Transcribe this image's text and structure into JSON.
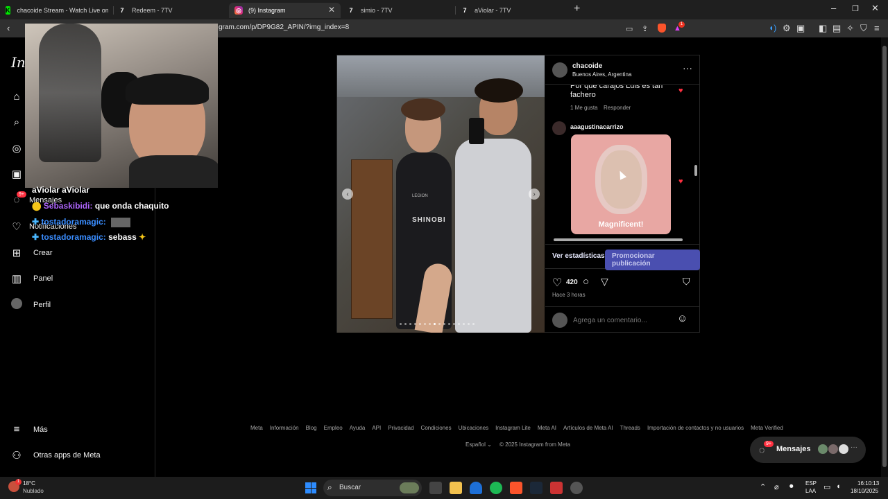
{
  "tabs": [
    {
      "title": "chacoide Stream - Watch Live on",
      "icon_color": "#00e701"
    },
    {
      "title": "Redeem - 7TV",
      "icon_color": "#ffffff"
    },
    {
      "title": "(9) Instagram",
      "icon_color": "#e1306c"
    },
    {
      "title": "simio - 7TV",
      "icon_color": "#ffffff"
    },
    {
      "title": "aViolar - 7TV",
      "icon_color": "#ffffff"
    }
  ],
  "address": {
    "url": "gram.com/p/DP9G82_APIN/?img_index=8"
  },
  "browser": {
    "notif_count": "1"
  },
  "stream": {
    "overlay_name": "aViolar aViolar",
    "chat": [
      {
        "user": "Sebaskibidi:",
        "text": "que onda chaquito",
        "color": "#b066ff"
      },
      {
        "user": "tostadoramagic:",
        "text": "",
        "color": "#3a8dff"
      },
      {
        "user": "tostadoramagic:",
        "text": "sebass",
        "color": "#3a8dff"
      }
    ]
  },
  "sidebar": {
    "logo": "Ins",
    "messages_badge": "9+",
    "items": [
      {
        "label": "Mensajes",
        "icon": "messenger-icon"
      },
      {
        "label": "Notificaciones",
        "icon": "heart-icon"
      },
      {
        "label": "Crear",
        "icon": "plus-square-icon"
      },
      {
        "label": "Panel",
        "icon": "chart-icon"
      },
      {
        "label": "Perfil",
        "icon": "avatar-icon"
      }
    ],
    "bottom": [
      {
        "label": "Más",
        "icon": "menu-icon"
      },
      {
        "label": "Otras apps de Meta",
        "icon": "meta-apps-icon"
      }
    ]
  },
  "post": {
    "author": "chacoide",
    "location": "Buenos Aires, Argentina",
    "comments": [
      {
        "text": "Por que carajos Luis es tan fachero",
        "likes": "1 Me gusta",
        "reply": "Responder"
      },
      {
        "user": "aaagustinacarrizo",
        "sticker_text": "Magnificent!"
      }
    ],
    "insights": "Ver estadísticas",
    "promote": "Promocionar publicación",
    "likes": "420",
    "time": "Hace 3 horas",
    "comment_placeholder": "Agrega un comentario...",
    "carousel_dots": 16,
    "carousel_active": 7,
    "photo_shirt": "SHINOBI",
    "photo_sponsor": "LEGION"
  },
  "footer": {
    "links": [
      "Meta",
      "Información",
      "Blog",
      "Empleo",
      "Ayuda",
      "API",
      "Privacidad",
      "Condiciones",
      "Ubicaciones",
      "Instagram Lite",
      "Meta AI",
      "Artículos de Meta AI",
      "Threads",
      "Importación de contactos y no usuarios",
      "Meta Verified"
    ],
    "language": "Español",
    "copyright": "© 2025 Instagram from Meta"
  },
  "messages_pill": {
    "label": "Mensajes",
    "badge": "9+"
  },
  "taskbar": {
    "weather_temp": "18°C",
    "weather_desc": "Nublado",
    "weather_badge": "1",
    "search": "Buscar",
    "lang": "ESP",
    "lang2": "LAA",
    "time": "16:10:13",
    "date": "18/10/2025"
  }
}
